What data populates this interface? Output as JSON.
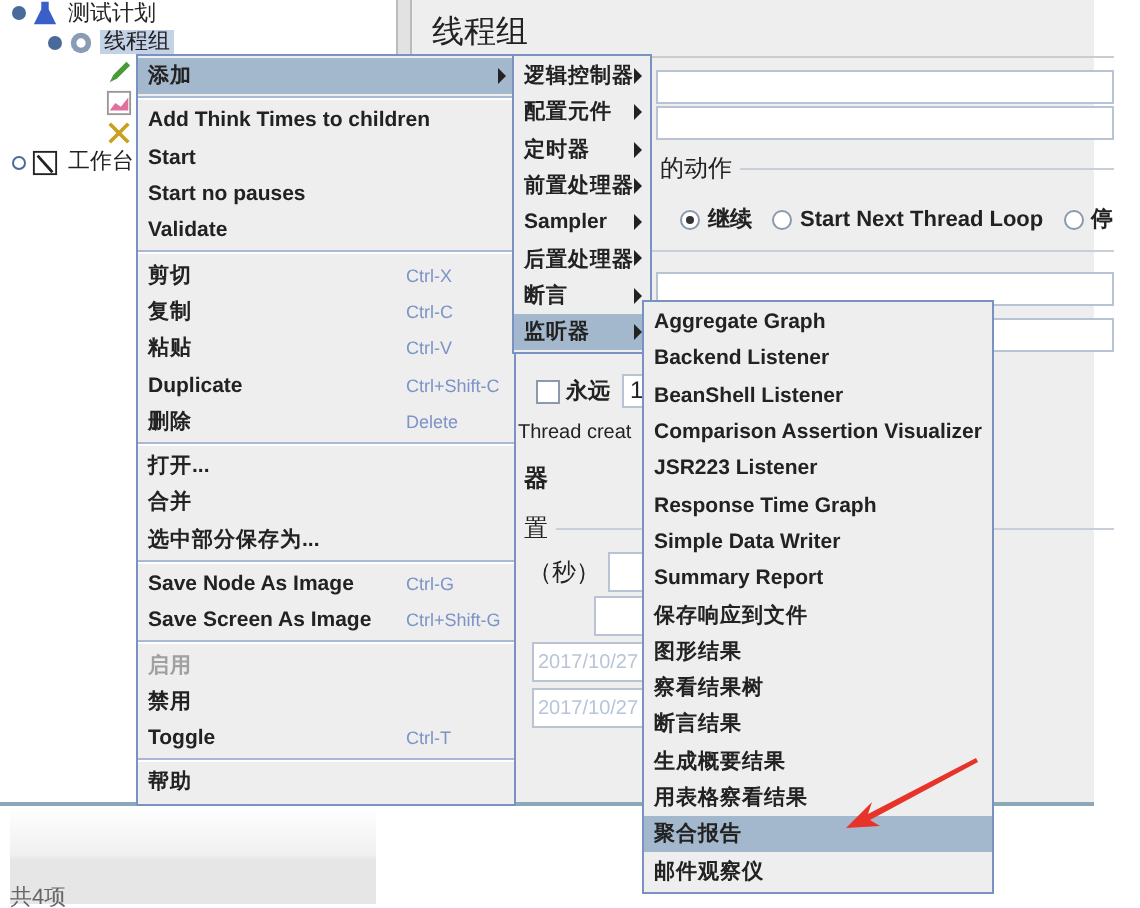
{
  "tree": [
    {
      "label": "测试计划",
      "expanded": true,
      "selected": false,
      "children": [
        {
          "label": "线程组",
          "expanded": true,
          "selected": true
        }
      ]
    },
    {
      "label": "工作台",
      "expanded": false,
      "selected": false
    }
  ],
  "panel": {
    "title": "线程组",
    "action_label": "的动作",
    "radios": [
      {
        "label": "继续",
        "selected": true
      },
      {
        "label": "Start Next Thread Loop",
        "selected": false
      },
      {
        "label": "停",
        "selected": false
      }
    ],
    "forever": {
      "label": "永远",
      "checked": false,
      "value": "1"
    },
    "thread_text": "Thread creat",
    "section_tail": "器",
    "schedule_label": "置",
    "seconds_label": "（秒）",
    "dates": [
      {
        "placeholder": "2017/10/27"
      },
      {
        "placeholder": "2017/10/27"
      }
    ]
  },
  "context_menu": [
    {
      "kind": "item",
      "label": "添加",
      "disabled": false,
      "selected": true,
      "submenu": true
    },
    {
      "kind": "separator"
    },
    {
      "kind": "item",
      "label": "Add Think Times to children",
      "disabled": false,
      "selected": false,
      "submenu": false
    },
    {
      "kind": "item",
      "label": "Start",
      "disabled": false,
      "selected": false,
      "submenu": false
    },
    {
      "kind": "item",
      "label": "Start no pauses",
      "disabled": false,
      "selected": false,
      "submenu": false
    },
    {
      "kind": "item",
      "label": "Validate",
      "disabled": false,
      "selected": false,
      "submenu": false
    },
    {
      "kind": "separator"
    },
    {
      "kind": "item",
      "label": "剪切",
      "shortcut": "Ctrl-X",
      "disabled": false,
      "selected": false,
      "submenu": false
    },
    {
      "kind": "item",
      "label": "复制",
      "shortcut": "Ctrl-C",
      "disabled": false,
      "selected": false,
      "submenu": false
    },
    {
      "kind": "item",
      "label": "粘贴",
      "shortcut": "Ctrl-V",
      "disabled": false,
      "selected": false,
      "submenu": false
    },
    {
      "kind": "item",
      "label": "Duplicate",
      "shortcut": "Ctrl+Shift-C",
      "disabled": false,
      "selected": false,
      "submenu": false
    },
    {
      "kind": "item",
      "label": "删除",
      "shortcut": "Delete",
      "disabled": false,
      "selected": false,
      "submenu": false
    },
    {
      "kind": "separator"
    },
    {
      "kind": "item",
      "label": "打开...",
      "disabled": false,
      "selected": false,
      "submenu": false
    },
    {
      "kind": "item",
      "label": "合并",
      "disabled": false,
      "selected": false,
      "submenu": false
    },
    {
      "kind": "item",
      "label": "选中部分保存为...",
      "disabled": false,
      "selected": false,
      "submenu": false
    },
    {
      "kind": "separator"
    },
    {
      "kind": "item",
      "label": "Save Node As Image",
      "shortcut": "Ctrl-G",
      "disabled": false,
      "selected": false,
      "submenu": false
    },
    {
      "kind": "item",
      "label": "Save Screen As Image",
      "shortcut": "Ctrl+Shift-G",
      "disabled": false,
      "selected": false,
      "submenu": false
    },
    {
      "kind": "separator"
    },
    {
      "kind": "item",
      "label": "启用",
      "disabled": true,
      "selected": false,
      "submenu": false
    },
    {
      "kind": "item",
      "label": "禁用",
      "disabled": false,
      "selected": false,
      "submenu": false
    },
    {
      "kind": "item",
      "label": "Toggle",
      "shortcut": "Ctrl-T",
      "disabled": false,
      "selected": false,
      "submenu": false
    },
    {
      "kind": "separator"
    },
    {
      "kind": "item",
      "label": "帮助",
      "disabled": false,
      "selected": false,
      "submenu": false
    }
  ],
  "add_submenu": [
    {
      "label": "逻辑控制器",
      "selected": false
    },
    {
      "label": "配置元件",
      "selected": false
    },
    {
      "label": "定时器",
      "selected": false
    },
    {
      "label": "前置处理器",
      "selected": false
    },
    {
      "label": "Sampler",
      "selected": false
    },
    {
      "label": "后置处理器",
      "selected": false
    },
    {
      "label": "断言",
      "selected": false
    },
    {
      "label": "监听器",
      "selected": true
    }
  ],
  "listener_submenu": [
    {
      "label": "Aggregate Graph",
      "selected": false
    },
    {
      "label": "Backend Listener",
      "selected": false
    },
    {
      "label": "BeanShell Listener",
      "selected": false
    },
    {
      "label": "Comparison Assertion Visualizer",
      "selected": false
    },
    {
      "label": "JSR223 Listener",
      "selected": false
    },
    {
      "label": "Response Time Graph",
      "selected": false
    },
    {
      "label": "Simple Data Writer",
      "selected": false
    },
    {
      "label": "Summary Report",
      "selected": false
    },
    {
      "label": "保存响应到文件",
      "selected": false
    },
    {
      "label": "图形结果",
      "selected": false
    },
    {
      "label": "察看结果树",
      "selected": false
    },
    {
      "label": "断言结果",
      "selected": false
    },
    {
      "label": "生成概要结果",
      "selected": false
    },
    {
      "label": "用表格察看结果",
      "selected": false
    },
    {
      "label": "聚合报告",
      "selected": true
    },
    {
      "label": "邮件观察仪",
      "selected": false
    }
  ],
  "status_text": "共4项"
}
